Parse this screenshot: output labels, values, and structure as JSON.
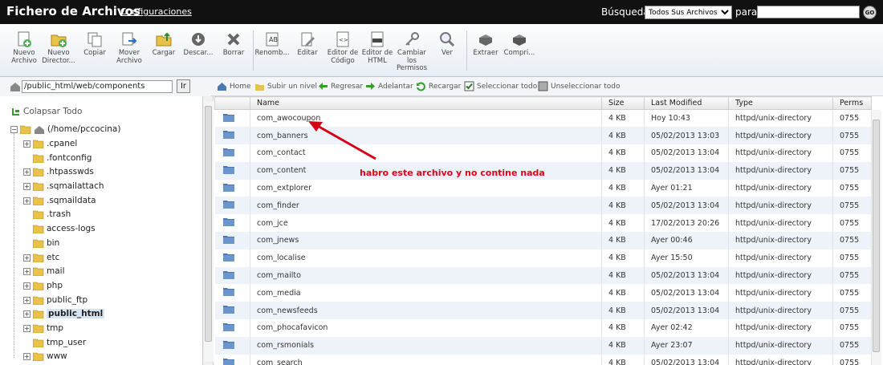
{
  "header": {
    "title": "Fichero de Archivos",
    "config_link": "Configuraciones",
    "search_label": "Búsqueda",
    "search_scope": "Todos Sus Archivos",
    "for_label": "para",
    "search_value": "",
    "go_label": "GO"
  },
  "toolbar": {
    "new_file": [
      "Nuevo",
      "Archivo"
    ],
    "new_folder": [
      "Nuevo",
      "Director..."
    ],
    "copy": [
      "Copiar"
    ],
    "move": [
      "Mover",
      "Archivo"
    ],
    "upload": [
      "Cargar"
    ],
    "download": [
      "Descar..."
    ],
    "delete": [
      "Borrar"
    ],
    "rename": [
      "Renomb..."
    ],
    "edit": [
      "Editar"
    ],
    "code_editor": [
      "Editor de",
      "Código"
    ],
    "html_editor": [
      "Editor de",
      "HTML"
    ],
    "permissions": [
      "Cambiar",
      "los",
      "Permisos"
    ],
    "view": [
      "Ver"
    ],
    "extract": [
      "Extraer"
    ],
    "compress": [
      "Compri..."
    ]
  },
  "pathbar": {
    "path": "/public_html/web/components",
    "go_label": "Ir"
  },
  "navbar": {
    "home": "Home",
    "up": "Subir un nivel",
    "back": "Regresar",
    "forward": "Adelantar",
    "reload": "Recargar",
    "select_all": "Seleccionar todo",
    "unselect_all": "Unseleccionar todo"
  },
  "tree": {
    "collapse_label": "Colapsar Todo",
    "root": "(/home/pccocina)",
    "items": [
      {
        "label": ".cpanel",
        "expandable": true
      },
      {
        "label": ".fontconfig",
        "expandable": false
      },
      {
        "label": ".htpasswds",
        "expandable": true
      },
      {
        "label": ".sqmailattach",
        "expandable": true
      },
      {
        "label": ".sqmaildata",
        "expandable": true
      },
      {
        "label": ".trash",
        "expandable": false
      },
      {
        "label": "access-logs",
        "expandable": false
      },
      {
        "label": "bin",
        "expandable": false
      },
      {
        "label": "etc",
        "expandable": true
      },
      {
        "label": "mail",
        "expandable": true
      },
      {
        "label": "php",
        "expandable": true
      },
      {
        "label": "public_ftp",
        "expandable": true
      },
      {
        "label": "public_html",
        "expandable": true,
        "selected": true
      },
      {
        "label": "tmp",
        "expandable": true
      },
      {
        "label": "tmp_user",
        "expandable": false
      },
      {
        "label": "www",
        "expandable": true
      }
    ]
  },
  "table": {
    "columns": [
      "Name",
      "Size",
      "Last Modified",
      "Type",
      "Perms"
    ],
    "rows": [
      {
        "name": "com_awocoupon",
        "size": "4 KB",
        "modified": "Hoy 10:43",
        "type": "httpd/unix-directory",
        "perms": "0755"
      },
      {
        "name": "com_banners",
        "size": "4 KB",
        "modified": "05/02/2013 13:03",
        "type": "httpd/unix-directory",
        "perms": "0755"
      },
      {
        "name": "com_contact",
        "size": "4 KB",
        "modified": "05/02/2013 13:04",
        "type": "httpd/unix-directory",
        "perms": "0755"
      },
      {
        "name": "com_content",
        "size": "4 KB",
        "modified": "05/02/2013 13:04",
        "type": "httpd/unix-directory",
        "perms": "0755"
      },
      {
        "name": "com_extplorer",
        "size": "4 KB",
        "modified": "Ayer 01:21",
        "type": "httpd/unix-directory",
        "perms": "0755"
      },
      {
        "name": "com_finder",
        "size": "4 KB",
        "modified": "05/02/2013 13:04",
        "type": "httpd/unix-directory",
        "perms": "0755"
      },
      {
        "name": "com_jce",
        "size": "4 KB",
        "modified": "17/02/2013 20:26",
        "type": "httpd/unix-directory",
        "perms": "0755"
      },
      {
        "name": "com_jnews",
        "size": "4 KB",
        "modified": "Ayer 00:46",
        "type": "httpd/unix-directory",
        "perms": "0755"
      },
      {
        "name": "com_localise",
        "size": "4 KB",
        "modified": "Ayer 15:50",
        "type": "httpd/unix-directory",
        "perms": "0755"
      },
      {
        "name": "com_mailto",
        "size": "4 KB",
        "modified": "05/02/2013 13:04",
        "type": "httpd/unix-directory",
        "perms": "0755"
      },
      {
        "name": "com_media",
        "size": "4 KB",
        "modified": "05/02/2013 13:04",
        "type": "httpd/unix-directory",
        "perms": "0755"
      },
      {
        "name": "com_newsfeeds",
        "size": "4 KB",
        "modified": "05/02/2013 13:04",
        "type": "httpd/unix-directory",
        "perms": "0755"
      },
      {
        "name": "com_phocafavicon",
        "size": "4 KB",
        "modified": "Ayer 02:42",
        "type": "httpd/unix-directory",
        "perms": "0755"
      },
      {
        "name": "com_rsmonials",
        "size": "4 KB",
        "modified": "Ayer 23:07",
        "type": "httpd/unix-directory",
        "perms": "0755"
      },
      {
        "name": "com_search",
        "size": "4 KB",
        "modified": "05/02/2013 13:04",
        "type": "httpd/unix-directory",
        "perms": "0755"
      }
    ]
  },
  "annotation": "habro este archivo y no contine nada",
  "colors": {
    "header_bg": "#111111",
    "row_alt": "#eef3fa",
    "annotation": "#e4001b",
    "folder": "#4a79b5"
  }
}
